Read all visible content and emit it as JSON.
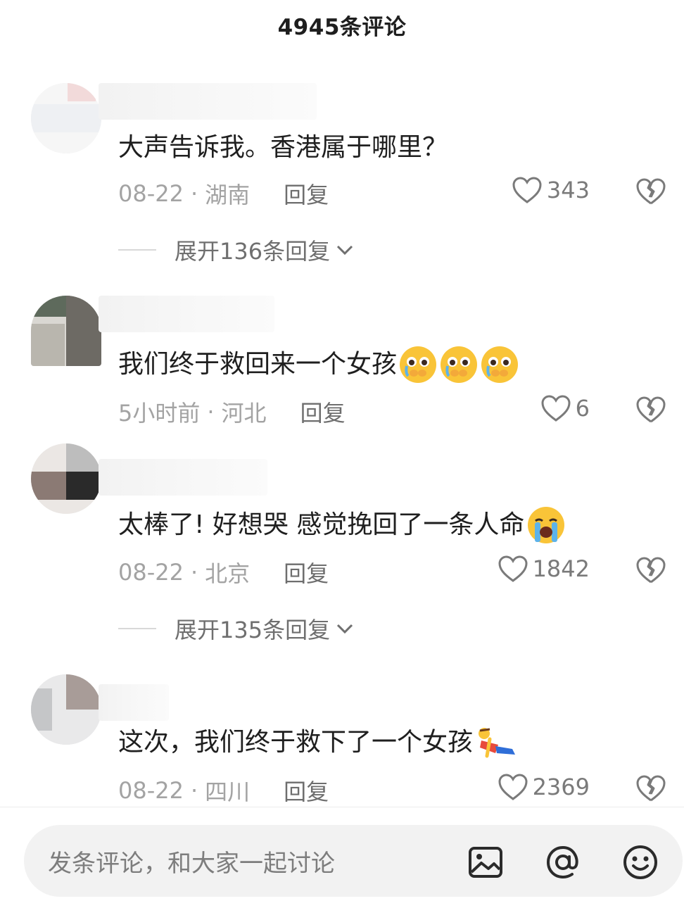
{
  "header": {
    "title": "4945条评论"
  },
  "comments": [
    {
      "text": "大声告诉我。香港属于哪里？",
      "time": "08-22",
      "location": "湖南",
      "reply_label": "回复",
      "likes": "343",
      "expand_label": "展开136条回复",
      "emojis": []
    },
    {
      "text": "我们终于救回来一个女孩",
      "time": "5小时前",
      "location": "河北",
      "reply_label": "回复",
      "likes": "6",
      "emojis": [
        "pleading-face-icon",
        "pleading-face-icon",
        "pleading-face-icon"
      ]
    },
    {
      "text": "太棒了! 好想哭 感觉挽回了一条人命",
      "time": "08-22",
      "location": "北京",
      "reply_label": "回复",
      "likes": "1842",
      "expand_label": "展开135条回复",
      "emojis": [
        "loudly-crying-face-icon"
      ]
    },
    {
      "text": "这次，我们终于救下了一个女孩",
      "time": "08-22",
      "location": "四川",
      "reply_label": "回复",
      "likes": "2369",
      "emojis": [
        "lying-person-icon"
      ]
    }
  ],
  "input": {
    "placeholder": "发条评论，和大家一起讨论"
  },
  "icons": {
    "image": "image-icon",
    "mention": "at-icon",
    "emoji": "smile-icon"
  },
  "colors": {
    "meta": "#a3a3a3",
    "text": "#1f1f1f",
    "input_bg": "#f2f2f2"
  }
}
